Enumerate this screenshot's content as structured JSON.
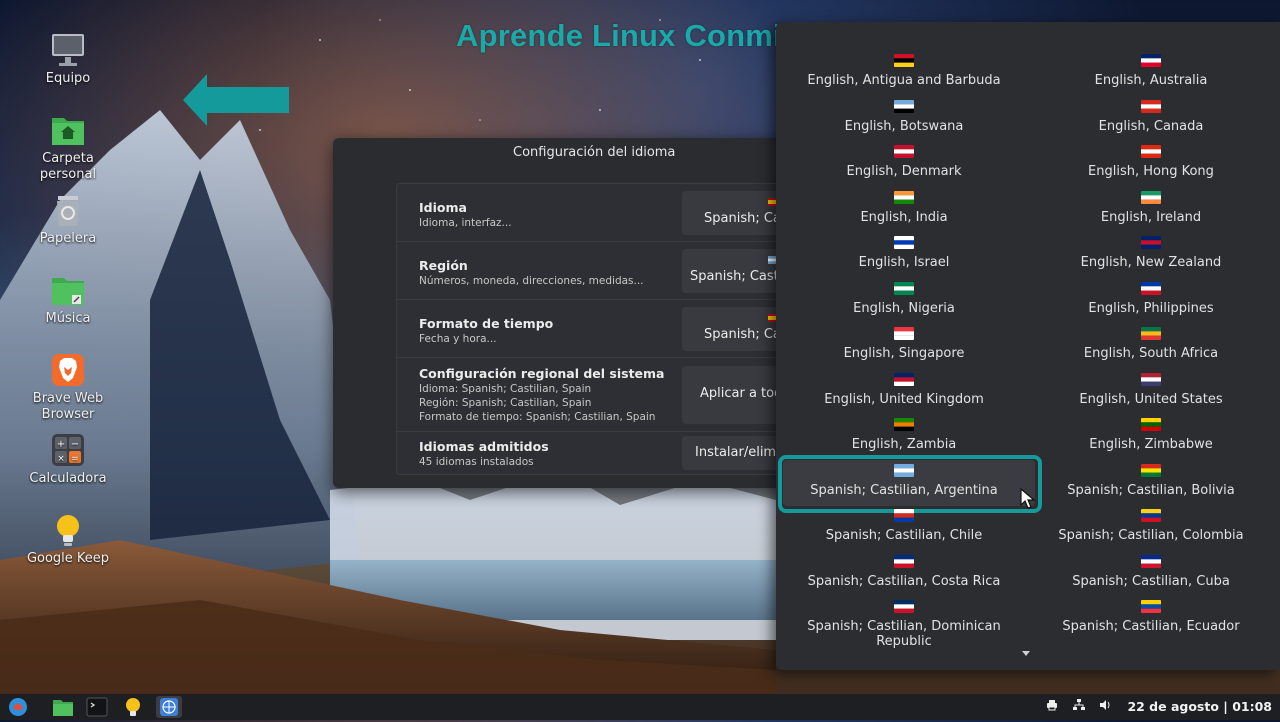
{
  "overlay": {
    "title": "Aprende Linux Conmigo",
    "accent": "#1aa8a8"
  },
  "desktop": {
    "icons": [
      {
        "label": "Equipo",
        "icon": "computer-icon"
      },
      {
        "label": "Carpeta\npersonal",
        "icon": "home-folder-icon"
      },
      {
        "label": "Papelera",
        "icon": "trash-icon"
      },
      {
        "label": "Música",
        "icon": "music-folder-icon"
      },
      {
        "label": "Brave Web\nBrowser",
        "icon": "brave-icon"
      },
      {
        "label": "Calculadora",
        "icon": "calculator-icon"
      },
      {
        "label": "Google Keep",
        "icon": "keep-icon"
      }
    ]
  },
  "dialog": {
    "title": "Configuración del idioma",
    "rows": [
      {
        "title": "Idioma",
        "subtitle": "Idioma, interfaz...",
        "button": "Spanish; Castilian, Spain"
      },
      {
        "title": "Región",
        "subtitle": "Números, moneda, direcciones, medidas...",
        "button": "Spanish; Castilian, Argentina"
      },
      {
        "title": "Formato de tiempo",
        "subtitle": "Fecha y hora...",
        "button": "Spanish; Castilian, Spain"
      },
      {
        "title": "Configuración regional del sistema",
        "lines": [
          "Idioma: Spanish; Castilian, Spain",
          "Región: Spanish; Castilian, Spain",
          "Formato de tiempo: Spanish; Castilian, Spain"
        ],
        "button": "Aplicar a todo el sistema"
      },
      {
        "title": "Idiomas admitidos",
        "subtitle": "45 idiomas instalados",
        "button": "Instalar/eliminar idiomas..."
      }
    ]
  },
  "languages": [
    [
      "English, Antigua and Barbuda",
      "English, Australia"
    ],
    [
      "English, Botswana",
      "English, Canada"
    ],
    [
      "English, Denmark",
      "English, Hong Kong"
    ],
    [
      "English, India",
      "English, Ireland"
    ],
    [
      "English, Israel",
      "English, New Zealand"
    ],
    [
      "English, Nigeria",
      "English, Philippines"
    ],
    [
      "English, Singapore",
      "English, South Africa"
    ],
    [
      "English, United Kingdom",
      "English, United States"
    ],
    [
      "English, Zambia",
      "English, Zimbabwe"
    ],
    [
      "Spanish; Castilian, Argentina",
      "Spanish; Castilian, Bolivia"
    ],
    [
      "Spanish; Castilian, Chile",
      "Spanish; Castilian, Colombia"
    ],
    [
      "Spanish; Castilian, Costa Rica",
      "Spanish; Castilian, Cuba"
    ],
    [
      "Spanish; Castilian, Dominican Republic",
      "Spanish; Castilian, Ecuador"
    ]
  ],
  "selected_language": "Spanish; Castilian, Argentina",
  "taskbar": {
    "apps": [
      "app-menu-icon",
      "file-manager-icon",
      "terminal-icon",
      "keep-icon",
      "language-settings-icon"
    ],
    "tray_icons": [
      "printer-icon",
      "network-icon",
      "volume-icon"
    ],
    "clock": "22 de agosto | 01:08"
  }
}
